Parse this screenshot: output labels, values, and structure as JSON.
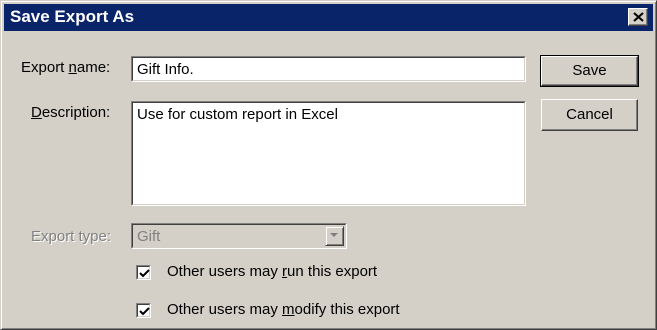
{
  "window": {
    "title": "Save Export As"
  },
  "form": {
    "export_name": {
      "label_prefix": "Export ",
      "label_access": "n",
      "label_suffix": "ame:",
      "value": "Gift Info."
    },
    "description": {
      "label_access": "D",
      "label_suffix": "escription:",
      "value": "Use for custom report in Excel"
    },
    "export_type": {
      "label": "Export type:",
      "value": "Gift",
      "enabled": false
    },
    "permissions": [
      {
        "label_prefix": "Other users may ",
        "label_access": "r",
        "label_suffix": "un this export",
        "checked": true
      },
      {
        "label_prefix": "Other users may ",
        "label_access": "m",
        "label_suffix": "odify this export",
        "checked": true
      }
    ]
  },
  "buttons": {
    "save": "Save",
    "cancel": "Cancel"
  },
  "colors": {
    "title_bar": "#0a246a",
    "dialog_face": "#d4d0c8",
    "field_bg": "#ffffff",
    "disabled_text": "#808080"
  },
  "icons": {
    "close": "close-icon",
    "dropdown": "chevron-down-icon",
    "check": "checkmark-icon"
  }
}
